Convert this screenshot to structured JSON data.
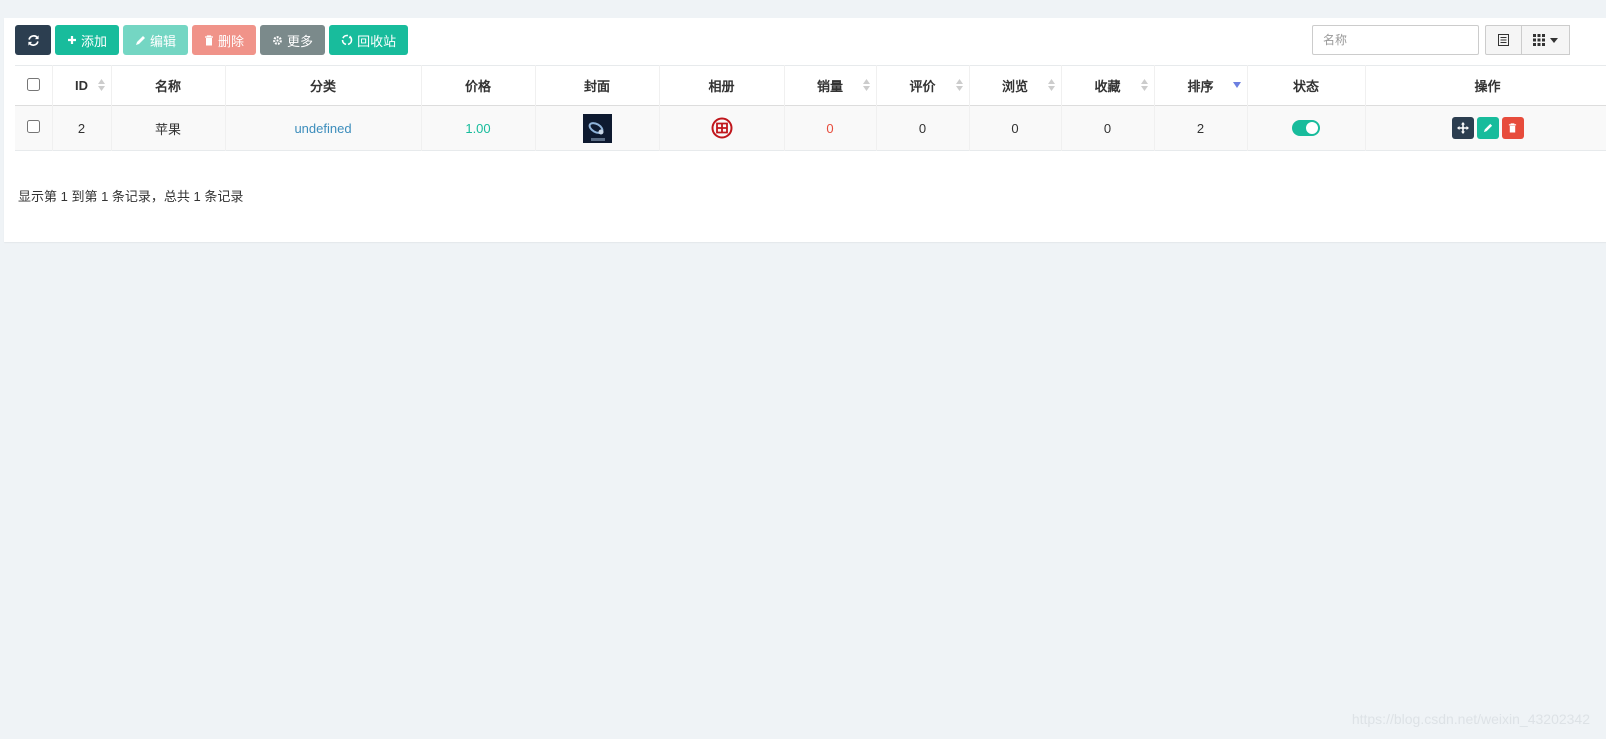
{
  "toolbar": {
    "refresh_icon": "refresh-icon",
    "add_label": "添加",
    "edit_label": "编辑",
    "delete_label": "删除",
    "more_label": "更多",
    "recycle_label": "回收站"
  },
  "search": {
    "placeholder": "名称",
    "value": ""
  },
  "table": {
    "headers": {
      "id": "ID",
      "name": "名称",
      "category": "分类",
      "price": "价格",
      "cover": "封面",
      "album": "相册",
      "sales": "销量",
      "rating": "评价",
      "views": "浏览",
      "favorites": "收藏",
      "sort": "排序",
      "status": "状态",
      "actions": "操作"
    },
    "rows": [
      {
        "id": "2",
        "name": "苹果",
        "category": "undefined",
        "price": "1.00",
        "sales": "0",
        "rating": "0",
        "views": "0",
        "favorites": "0",
        "sort": "2",
        "status_on": true
      }
    ]
  },
  "pager": {
    "info": "显示第 1 到第 1 条记录，总共 1 条记录"
  },
  "watermark": "https://blog.csdn.net/weixin_43202342",
  "colors": {
    "primary": "#18bc9c",
    "danger": "#e74c3c",
    "dark": "#2c3e50",
    "info": "#3c8dbc"
  }
}
